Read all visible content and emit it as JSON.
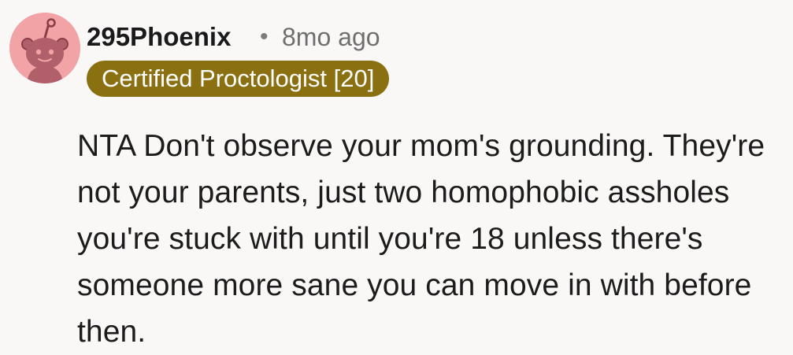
{
  "comment": {
    "avatar_icon": "reddit-snoo-avatar-icon",
    "avatar_color": "#f2a3a6",
    "username": "295Phoenix",
    "separator": "•",
    "timestamp": "8mo ago",
    "flair": {
      "label": "Certified Proctologist [20]",
      "background": "#8b7012",
      "text_color": "#ffffff"
    },
    "body": "NTA Don't observe your mom's grounding. They're not your parents, just two homophobic assholes you're stuck with until you're 18 unless there's someone more sane you can move in with before then."
  }
}
